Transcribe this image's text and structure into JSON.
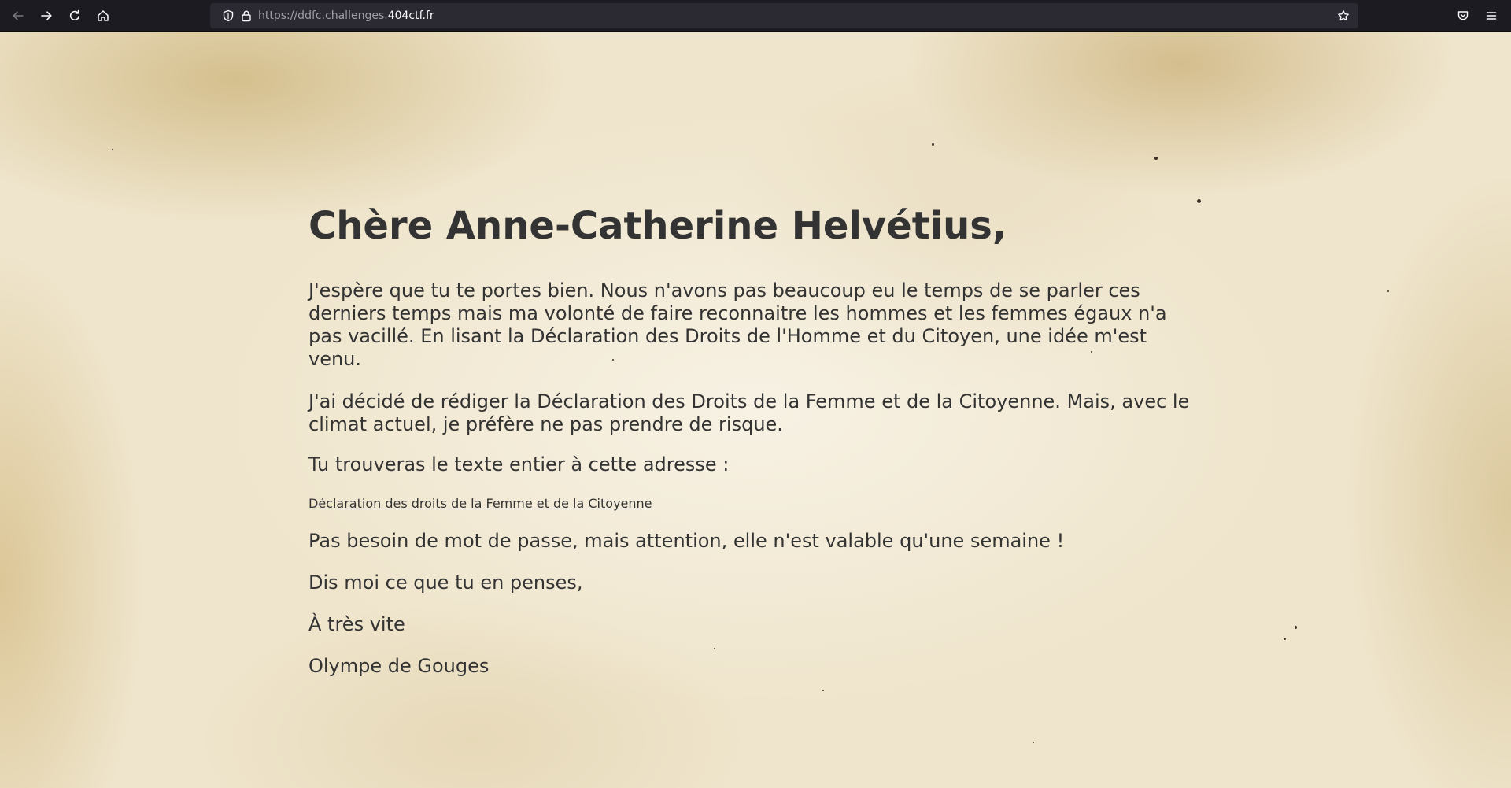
{
  "browser": {
    "url_prefix": "https://ddfc.challenges.",
    "url_domain": "404ctf.fr",
    "icons": [
      "back-arrow-icon",
      "forward-arrow-icon",
      "reload-icon",
      "home-icon",
      "shield-icon",
      "lock-icon",
      "star-icon",
      "pocket-icon",
      "hamburger-menu-icon"
    ]
  },
  "letter": {
    "heading": "Chère Anne-Catherine Helvétius,",
    "paragraph_1": "J'espère que tu te portes bien. Nous n'avons pas beaucoup eu le temps de se parler ces derniers temps mais ma volonté de faire reconnaitre les hommes et les femmes égaux n'a pas vacillé. En lisant la Déclaration des Droits de l'Homme et du Citoyen, une idée m'est venu.",
    "paragraph_2": "J'ai décidé de rédiger la Déclaration des Droits de la Femme et de la Citoyenne. Mais, avec le climat actuel, je préfère ne pas prendre de risque.",
    "paragraph_3": "Tu trouveras le texte entier à cette adresse :",
    "link_text": "Déclaration des droits de la Femme et de la Citoyenne",
    "paragraph_4": "Pas besoin de mot de passe, mais attention, elle n'est valable qu'une semaine !",
    "paragraph_5": "Dis moi ce que tu en penses,",
    "paragraph_6": "À très vite",
    "signature": "Olympe de Gouges"
  },
  "colors": {
    "toolbar": "#1c1b22",
    "urlbar": "#2b2a33",
    "paper": "#efe5cc",
    "text": "#333333"
  }
}
